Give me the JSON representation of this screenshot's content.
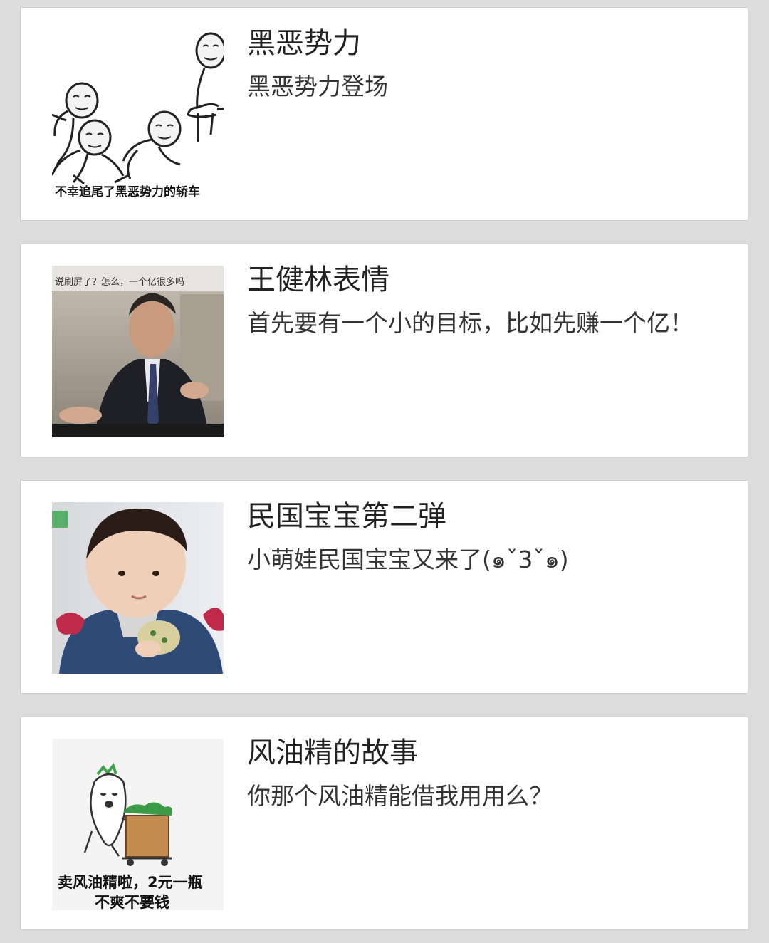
{
  "items": [
    {
      "title": "黑恶势力",
      "desc": "黑恶势力登场",
      "thumb_caption": "不幸追尾了黑恶势力的轿车"
    },
    {
      "title": "王健林表情",
      "desc": "首先要有一个小的目标，比如先赚一个亿！",
      "thumb_caption": "说刷屏了？怎么，一个亿很多吗"
    },
    {
      "title": "民国宝宝第二弹",
      "desc": "小萌娃民国宝宝又来了(๑ˇ3ˇ๑)",
      "thumb_caption": ""
    },
    {
      "title": "风油精的故事",
      "desc": "你那个风油精能借我用用么？",
      "thumb_caption_line1": "卖风油精啦，2元一瓶",
      "thumb_caption_line2": "不爽不要钱"
    }
  ],
  "colors": {
    "background": "#dcdcdc",
    "card": "#ffffff",
    "title": "#222222",
    "desc": "#333333"
  }
}
